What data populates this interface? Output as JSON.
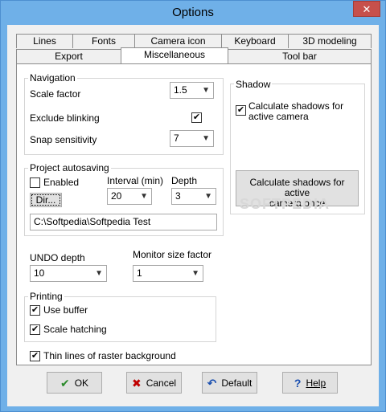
{
  "window": {
    "title": "Options",
    "close_glyph": "✕"
  },
  "tabs_row1": [
    "Lines",
    "Fonts",
    "Camera icon",
    "Keyboard",
    "3D modeling"
  ],
  "tabs_row2": [
    "Export",
    "Miscellaneous",
    "Tool bar"
  ],
  "active_tab": "Miscellaneous",
  "navigation": {
    "title": "Navigation",
    "scale_factor_label": "Scale factor",
    "scale_factor_value": "1.5",
    "exclude_blinking_label": "Exclude blinking",
    "exclude_blinking_checked": true,
    "snap_sensitivity_label": "Snap sensitivity",
    "snap_sensitivity_value": "7"
  },
  "shadow": {
    "title": "Shadow",
    "calc_label_line1": "Calculate shadows for",
    "calc_label_line2": "active camera",
    "calc_checked": true,
    "calc_once_line1": "Calculate shadows for active",
    "calc_once_line2": "camera once"
  },
  "autosave": {
    "title": "Project autosaving",
    "enabled_label": "Enabled",
    "enabled_checked": false,
    "interval_label": "Interval (min)",
    "interval_value": "20",
    "depth_label": "Depth",
    "depth_value": "3",
    "dir_button": "Dir...",
    "path_value": "C:\\Softpedia\\Softpedia Test"
  },
  "undo": {
    "label": "UNDO depth",
    "value": "10"
  },
  "monitor": {
    "label": "Monitor size factor",
    "value": "1"
  },
  "printing": {
    "title": "Printing",
    "use_buffer_label": "Use buffer",
    "use_buffer_checked": true,
    "scale_hatching_label": "Scale hatching",
    "scale_hatching_checked": true
  },
  "thin_lines": {
    "label": "Thin lines of raster background",
    "checked": true
  },
  "buttons": {
    "ok": "OK",
    "cancel": "Cancel",
    "default": "Default",
    "help": "Help"
  },
  "watermark": "SOFTPEDIA",
  "icons": {
    "dropdown": "chevron-down-icon",
    "ok": "checkmark-icon",
    "cancel": "x-icon",
    "default": "undo-arrow-icon",
    "help": "question-mark-icon"
  },
  "colors": {
    "titlebar": "#6fb0e8",
    "close": "#c7504b",
    "ok_icon": "#2a8a2a",
    "cancel_icon": "#c00000",
    "default_icon": "#1a4fb0",
    "help_icon": "#1a4fb0"
  }
}
